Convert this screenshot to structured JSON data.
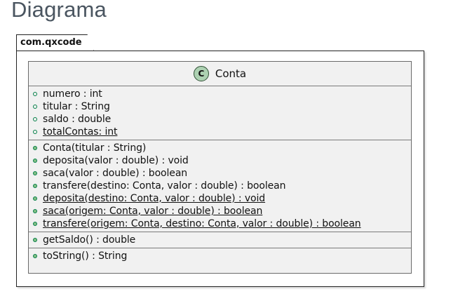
{
  "page": {
    "heading": "Diagrama"
  },
  "package": {
    "name": "com.qxcode"
  },
  "class": {
    "stereotype": "C",
    "name": "Conta",
    "fields": [
      {
        "text": "numero : int",
        "static": false
      },
      {
        "text": "titular : String",
        "static": false
      },
      {
        "text": "saldo : double",
        "static": false
      },
      {
        "text": "totalContas: int",
        "static": true
      }
    ],
    "methods": [
      {
        "text": "Conta(titular : String)",
        "static": false
      },
      {
        "text": "deposita(valor : double) : void",
        "static": false
      },
      {
        "text": "saca(valor : double) : boolean",
        "static": false
      },
      {
        "text": "transfere(destino: Conta, valor : double) : boolean",
        "static": false
      },
      {
        "text": "deposita(destino: Conta, valor : double) : void",
        "static": true
      },
      {
        "text": "saca(origem: Conta, valor : double) : boolean",
        "static": true
      },
      {
        "text": "transfere(origem: Conta, destino: Conta, valor : double) : boolean",
        "static": true
      }
    ],
    "getters": [
      {
        "text": "getSaldo() : double",
        "static": false
      }
    ],
    "others": [
      {
        "text": "toString() : String",
        "static": false
      }
    ]
  },
  "colors": {
    "stereotype_fill": "#add1b2",
    "visibility_public": "#038048",
    "class_fill": "#f1f1f1"
  }
}
